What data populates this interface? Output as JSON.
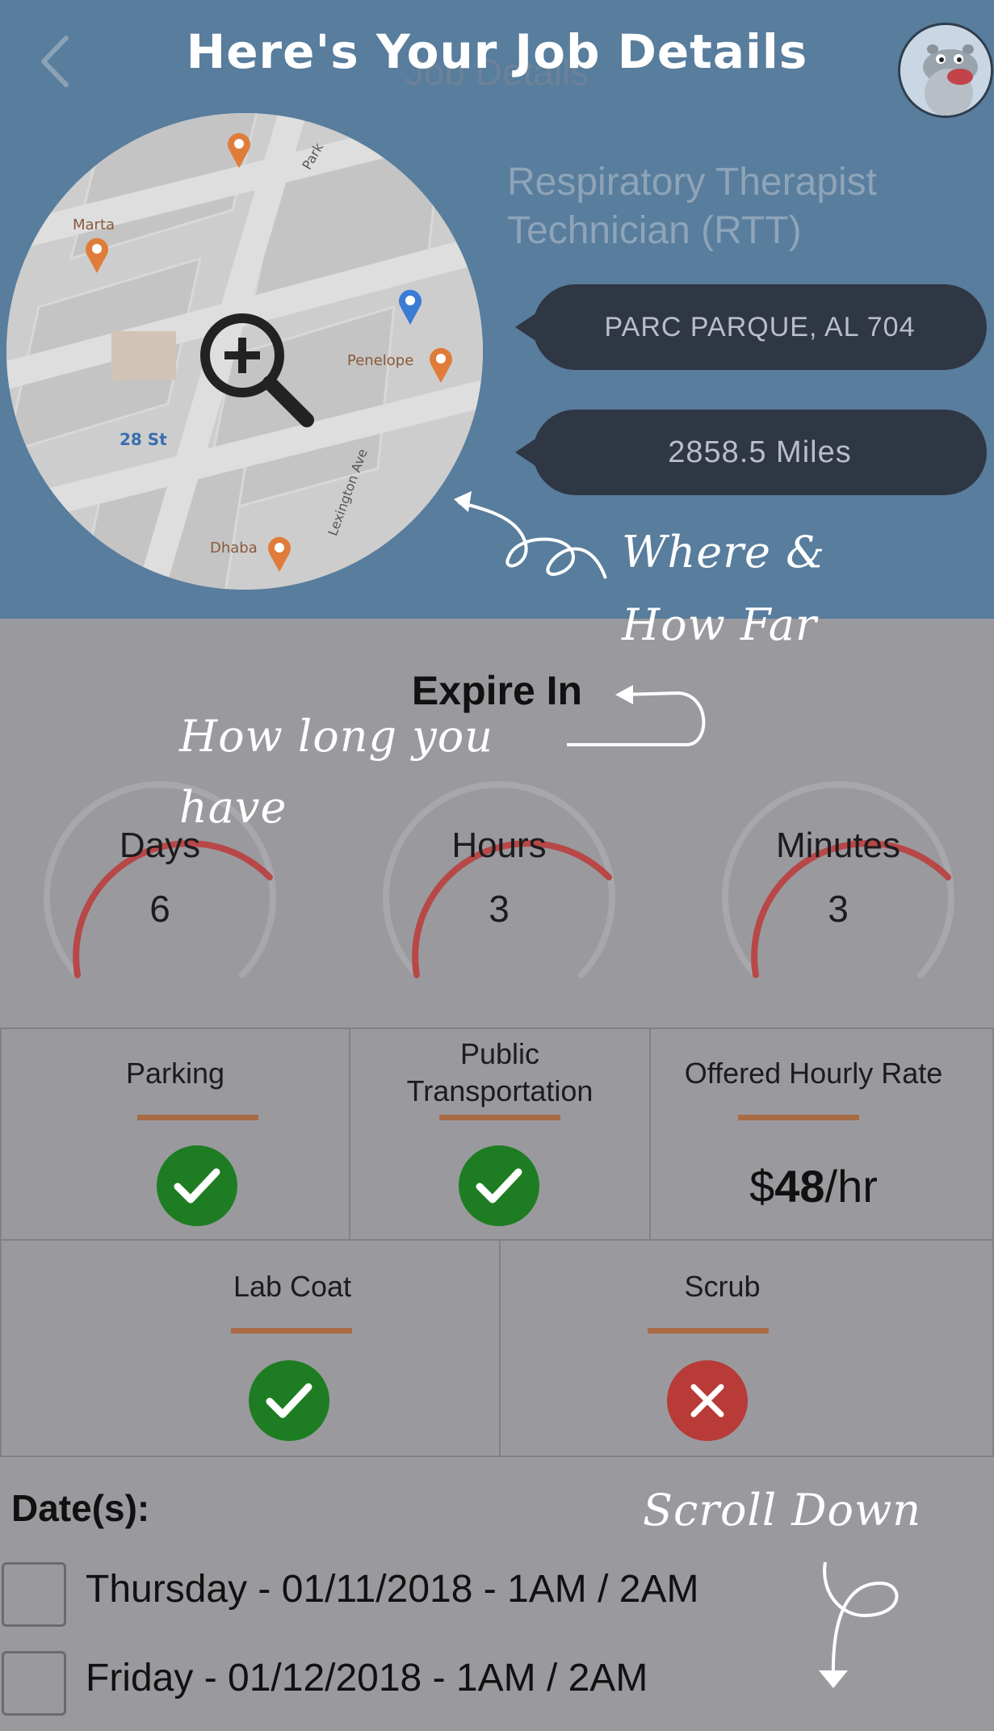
{
  "header": {
    "nav_title": "Job Details",
    "overlay_title": "Here's Your Job Details"
  },
  "map": {
    "places": [
      "Marta",
      "Penelope",
      "Dhaba"
    ],
    "station": "28 St",
    "streets": [
      "Park",
      "Lexington Ave"
    ]
  },
  "job": {
    "title": "Respiratory Therapist Technician (RTT)",
    "location": "PARC PARQUE, AL 704",
    "distance": "2858.5 Miles"
  },
  "annotations": {
    "where": "Where &",
    "how_far": "How Far",
    "how_long": "How long you",
    "have": "have",
    "scroll": "Scroll Down"
  },
  "expire": {
    "title": "Expire In",
    "days_label": "Days",
    "days_value": "6",
    "hours_label": "Hours",
    "hours_value": "3",
    "minutes_label": "Minutes",
    "minutes_value": "3"
  },
  "features": {
    "parking": {
      "label": "Parking",
      "status": "yes"
    },
    "public_transportation": {
      "label_line1": "Public",
      "label_line2": "Transportation",
      "status": "yes"
    },
    "rate": {
      "label": "Offered Hourly Rate",
      "currency": "$",
      "amount": "48",
      "unit": "/hr"
    },
    "lab_coat": {
      "label": "Lab Coat",
      "status": "yes"
    },
    "scrub": {
      "label": "Scrub",
      "status": "no"
    }
  },
  "dates": {
    "title": "Date(s):",
    "items": [
      "Thursday - 01/11/2018 - 1AM  / 2AM",
      "Friday - 01/12/2018 - 1AM  / 2AM"
    ]
  },
  "colors": {
    "header_bg": "#587d9d",
    "body_bg": "#9a9a9e",
    "pill_bg": "#2f3644",
    "accent_underline": "#a96b45",
    "yes": "#1e7d22",
    "no": "#b83b38"
  },
  "icons": {
    "back": "chevron-left-icon",
    "zoom": "magnifier-plus-icon",
    "check": "checkmark-icon",
    "cross": "x-icon"
  }
}
